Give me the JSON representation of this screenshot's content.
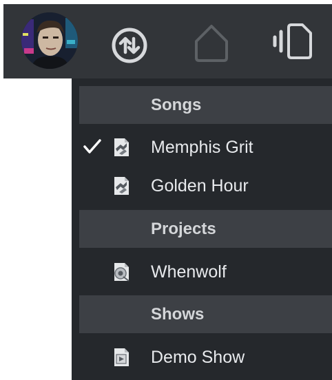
{
  "toolbar": {
    "avatar_icon": "user-avatar",
    "sync_icon": "up-down-arrows-icon",
    "home_icon": "home-icon",
    "device_icon": "device-icon",
    "colors": {
      "background": "#323539",
      "icon": "#d7d9dc",
      "icon_dim": "#5d6165"
    }
  },
  "menu": {
    "sections": [
      {
        "label": "Songs",
        "items": [
          {
            "label": "Memphis Grit",
            "icon": "song-file-icon",
            "checked": true
          },
          {
            "label": "Golden Hour",
            "icon": "song-file-icon",
            "checked": false
          }
        ]
      },
      {
        "label": "Projects",
        "items": [
          {
            "label": "Whenwolf",
            "icon": "project-file-icon",
            "checked": false
          }
        ]
      },
      {
        "label": "Shows",
        "items": [
          {
            "label": "Demo Show",
            "icon": "show-file-icon",
            "checked": false
          }
        ]
      }
    ],
    "colors": {
      "background": "#25282c",
      "header": "#3d4045",
      "text": "#e8eaed"
    }
  }
}
